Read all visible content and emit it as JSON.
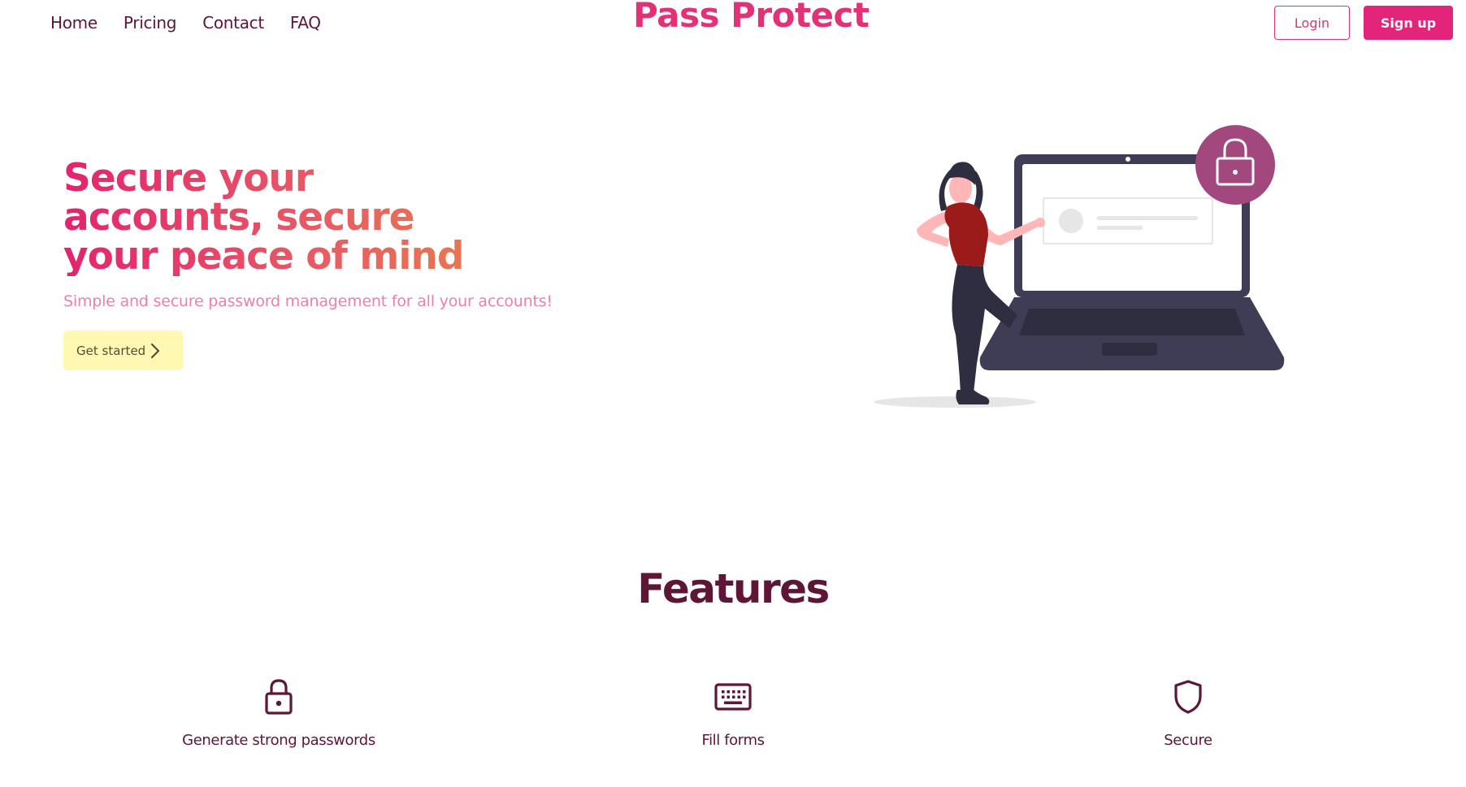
{
  "nav": {
    "links": [
      "Home",
      "Pricing",
      "Contact",
      "FAQ"
    ]
  },
  "brand": {
    "name": "Pass Protect"
  },
  "auth": {
    "login_label": "Login",
    "signup_label": "Sign up"
  },
  "hero": {
    "title": "Secure your accounts, secure your peace of mind",
    "subtitle": "Simple and secure password management for all your accounts!",
    "cta_label": "Get started",
    "cta_icon": "chevron-right-icon"
  },
  "features": {
    "title": "Features",
    "items": [
      {
        "label": "Generate strong passwords",
        "icon": "lock-icon"
      },
      {
        "label": "Fill forms",
        "icon": "keyboard-icon"
      },
      {
        "label": "Secure",
        "icon": "shield-icon"
      }
    ]
  },
  "colors": {
    "brand_pink": "#e23177",
    "dark_maroon": "#5e1636",
    "cta_yellow": "#fff8b3",
    "lock_badge": "#a3487f"
  }
}
